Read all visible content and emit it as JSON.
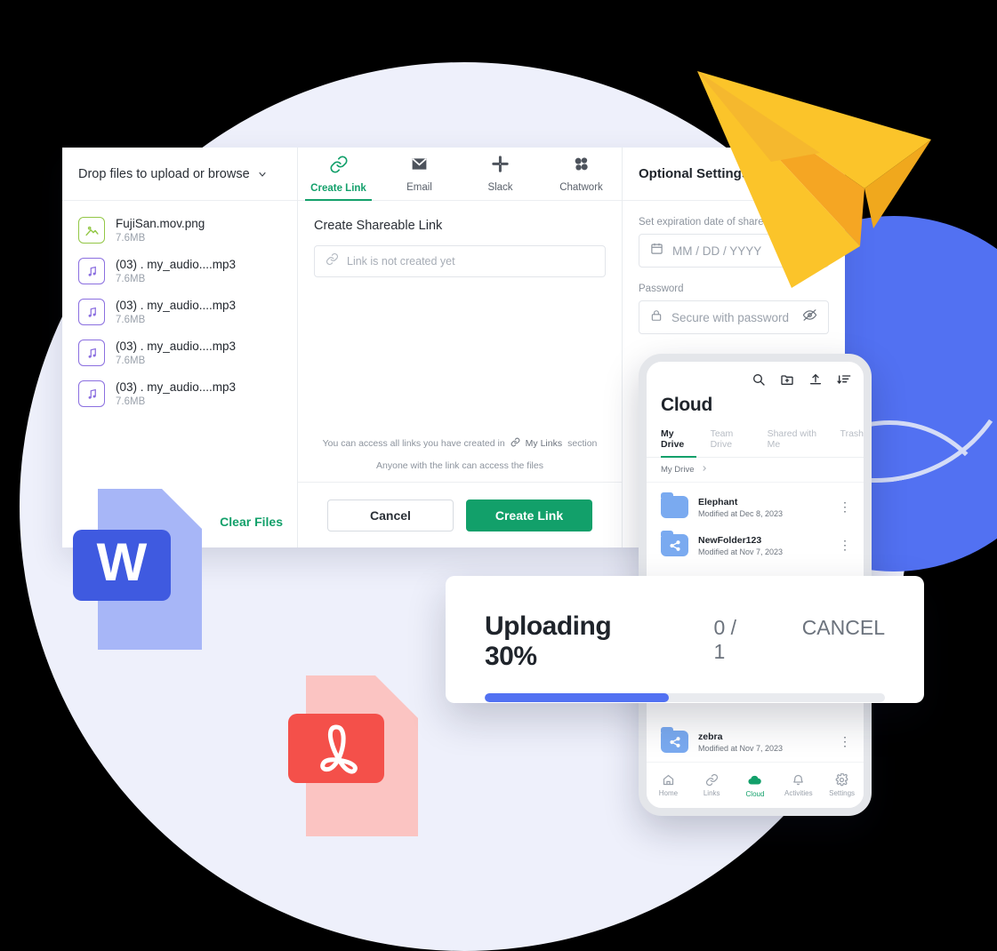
{
  "panel": {
    "left": {
      "drop_label": "Drop files to upload or browse",
      "chevron_icon": "chevron-down-icon",
      "files": [
        {
          "name": "FujiSan.mov.png",
          "size": "7.6MB",
          "kind": "image",
          "icon": "image-file-icon"
        },
        {
          "name": "(03) . my_audio....mp3",
          "size": "7.6MB",
          "kind": "audio",
          "icon": "audio-file-icon"
        },
        {
          "name": "(03) . my_audio....mp3",
          "size": "7.6MB",
          "kind": "audio",
          "icon": "audio-file-icon"
        },
        {
          "name": "(03) . my_audio....mp3",
          "size": "7.6MB",
          "kind": "audio",
          "icon": "audio-file-icon"
        },
        {
          "name": "(03) . my_audio....mp3",
          "size": "7.6MB",
          "kind": "audio",
          "icon": "audio-file-icon"
        }
      ],
      "clear_files_label": "Clear Files"
    },
    "tabs": [
      {
        "label": "Create Link",
        "icon": "link-icon",
        "active": true
      },
      {
        "label": "Email",
        "icon": "envelope-icon",
        "active": false
      },
      {
        "label": "Slack",
        "icon": "slack-icon",
        "active": false
      },
      {
        "label": "Chatwork",
        "icon": "chatwork-icon",
        "active": false
      }
    ],
    "middle": {
      "title": "Create Shareable Link",
      "link_placeholder": "Link is not created yet",
      "link_icon": "link-icon",
      "note_prefix": "You can access all links you have created in",
      "note_link": "My Links",
      "note_suffix": "section",
      "note_secondary": "Anyone with the link can access the files",
      "cancel_label": "Cancel",
      "create_label": "Create Link"
    },
    "right": {
      "title": "Optional Settings",
      "expiration_label": "Set expiration date of shared",
      "expiration_placeholder": "MM / DD / YYYY",
      "calendar_icon": "calendar-icon",
      "password_label": "Password",
      "password_placeholder": "Secure with password",
      "lock_icon": "lock-icon",
      "eye_icon": "eye-off-icon"
    }
  },
  "phone": {
    "top_icons": [
      "search-icon",
      "new-folder-icon",
      "upload-icon",
      "sort-icon"
    ],
    "title": "Cloud",
    "tabs": [
      {
        "label": "My Drive",
        "active": true
      },
      {
        "label": "Team Drive",
        "active": false
      },
      {
        "label": "Shared with Me",
        "active": false
      },
      {
        "label": "Trash",
        "active": false
      }
    ],
    "breadcrumb": "My Drive",
    "breadcrumb_icon": "chevron-right-icon",
    "rows": [
      {
        "name": "Elephant",
        "modified": "Modified at Dec 8, 2023",
        "icon": "folder-icon",
        "menu_icon": "kebab-menu-icon"
      },
      {
        "name": "NewFolder123",
        "modified": "Modified at Nov 7, 2023",
        "icon": "shared-folder-icon",
        "menu_icon": "kebab-menu-icon"
      },
      {
        "name": "zebra",
        "modified": "Modified at Nov 7, 2023",
        "icon": "shared-folder-icon",
        "menu_icon": "kebab-menu-icon"
      }
    ],
    "nav": [
      {
        "label": "Home",
        "icon": "home-icon",
        "active": false
      },
      {
        "label": "Links",
        "icon": "link-icon",
        "active": false
      },
      {
        "label": "Cloud",
        "icon": "cloud-icon",
        "active": true
      },
      {
        "label": "Activities",
        "icon": "bell-icon",
        "active": false
      },
      {
        "label": "Settings",
        "icon": "gear-icon",
        "active": false
      }
    ]
  },
  "upload": {
    "title": "Uploading 30%",
    "count": "0 / 1",
    "cancel_label": "CANCEL",
    "progress_percent": 30
  },
  "decor": {
    "word_icon": "word-document-icon",
    "word_letter": "W",
    "pdf_icon": "pdf-document-icon",
    "plane_icon": "paper-plane-icon"
  },
  "colors": {
    "accent_green": "#12a06a",
    "accent_blue": "#5271f2",
    "plane_yellow": "#fbc42a",
    "word_blue": "#3f5ae0",
    "pdf_red": "#f4504a",
    "lavender": "#eef0fb"
  }
}
